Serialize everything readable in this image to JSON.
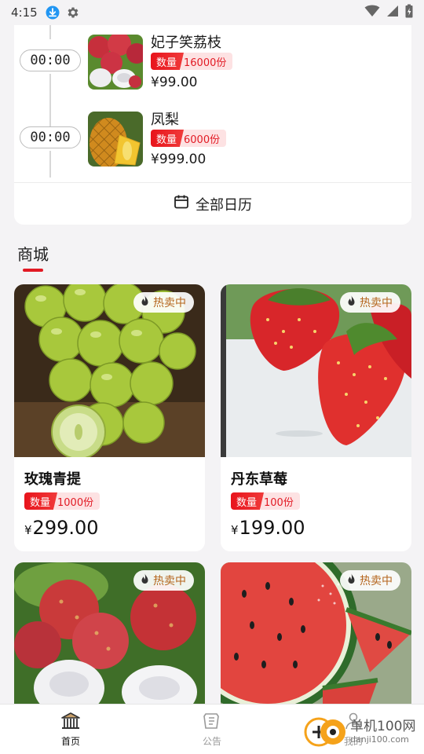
{
  "status_bar": {
    "time": "4:15"
  },
  "schedule": {
    "items": [
      {
        "time": "00:00",
        "name": "妃子笑荔枝",
        "qty_label": "数量",
        "qty_value": "16000份",
        "price": "¥99.00",
        "image": "lychee"
      },
      {
        "time": "00:00",
        "name": "凤梨",
        "qty_label": "数量",
        "qty_value": "6000份",
        "price": "¥999.00",
        "image": "pineapple"
      }
    ],
    "calendar_label": "全部日历"
  },
  "mall": {
    "title": "商城",
    "products": [
      {
        "name": "玫瑰青提",
        "badge": "热卖中",
        "qty_label": "数量",
        "qty_value": "1000份",
        "currency": "¥",
        "amount": "299.00",
        "image": "green-grapes"
      },
      {
        "name": "丹东草莓",
        "badge": "热卖中",
        "qty_label": "数量",
        "qty_value": "100份",
        "currency": "¥",
        "amount": "199.00",
        "image": "strawberries"
      },
      {
        "name": "",
        "badge": "热卖中",
        "image": "lychee"
      },
      {
        "name": "",
        "badge": "热卖中",
        "image": "watermelon"
      }
    ]
  },
  "bottom_nav": {
    "items": [
      {
        "label": "首页",
        "icon": "home-icon",
        "active": true
      },
      {
        "label": "公告",
        "icon": "announcement-icon",
        "active": false
      },
      {
        "label": "我的",
        "icon": "profile-icon",
        "active": false
      }
    ]
  },
  "watermark": {
    "cn": "单机100网",
    "en": "danji100.com"
  },
  "colors": {
    "accent": "#e21a24",
    "badge_text": "#b5651d",
    "background": "#f4f3f5"
  }
}
